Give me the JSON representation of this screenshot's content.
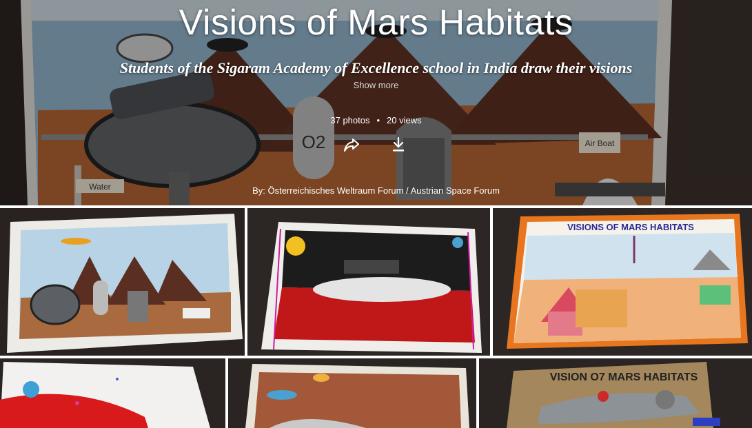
{
  "album": {
    "title": "Visions of Mars Habitats",
    "description": "Students of the Sigaram Academy of Excellence school in India draw their visions",
    "show_more_label": "Show more",
    "photos_count": "37 photos",
    "views_count": "20 views",
    "byline": "By: Österreichisches Weltraum Forum / Austrian Space Forum"
  },
  "hero_drawing_labels": {
    "o2": "O2",
    "water": "Water",
    "air_boat": "Air Boat"
  },
  "photos": [
    {
      "caption_on_paper": ""
    },
    {
      "caption_on_paper": ""
    },
    {
      "caption_on_paper": "VISIONS OF MARS HABITATS"
    },
    {
      "caption_on_paper": ""
    },
    {
      "caption_on_paper": ""
    },
    {
      "caption_on_paper": "VISION O7 MARS HABITATS"
    }
  ],
  "icons": {
    "share": "share-icon",
    "download": "download-icon"
  }
}
